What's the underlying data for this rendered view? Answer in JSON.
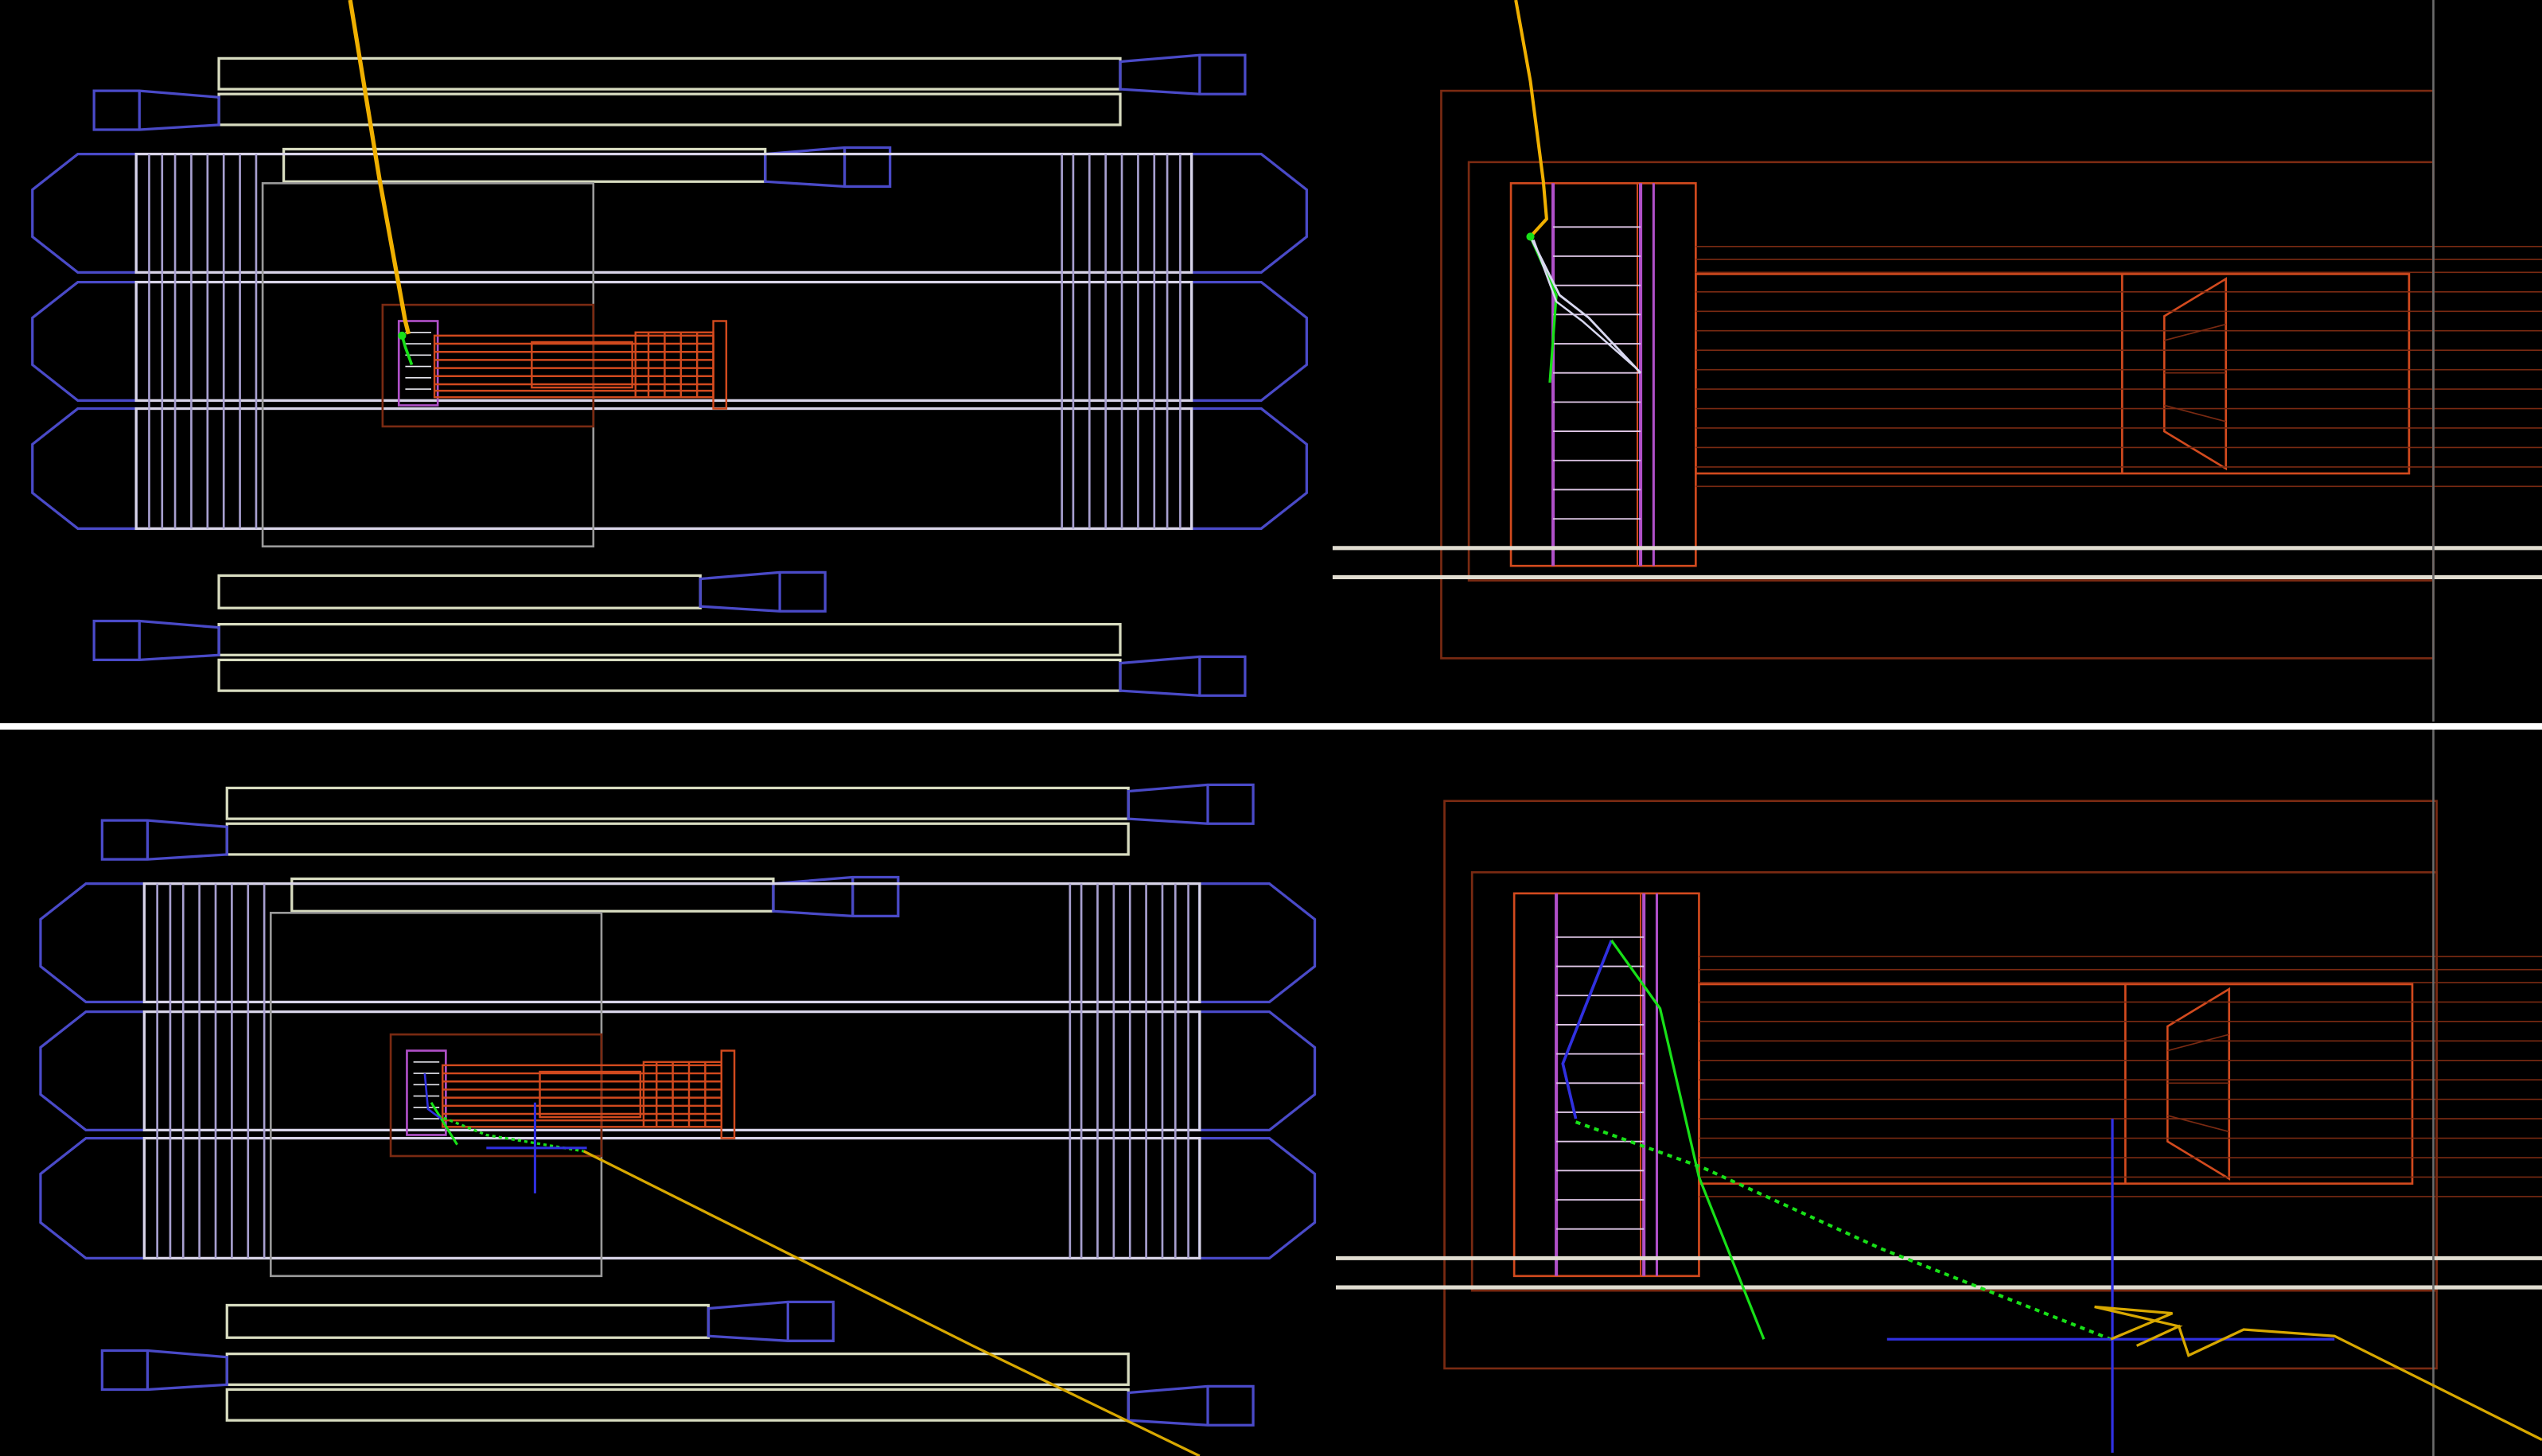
{
  "colors": {
    "background": "#000000",
    "pmt": "#4a4ac8",
    "rail": "#d8dcc0",
    "frame": "#c8c8c8",
    "detector": "#d24a1e",
    "detector_dim": "#7a2a12",
    "scintillator": "#b050c8",
    "panel_stripe": "#a8a0d0",
    "gamma_track": "#f0b000",
    "electron_track": "#18e018",
    "neutral_track": "#3030e0",
    "divider": "#ffffff",
    "enclosure": "#7a2a12",
    "axis_line": "#6a6a6a"
  },
  "views": [
    {
      "id": "top-left",
      "kind": "overview",
      "event": "event-1"
    },
    {
      "id": "top-right",
      "kind": "zoom",
      "event": "event-1"
    },
    {
      "id": "bottom-left",
      "kind": "overview",
      "event": "event-2"
    },
    {
      "id": "bottom-right",
      "kind": "zoom",
      "event": "event-2"
    }
  ]
}
